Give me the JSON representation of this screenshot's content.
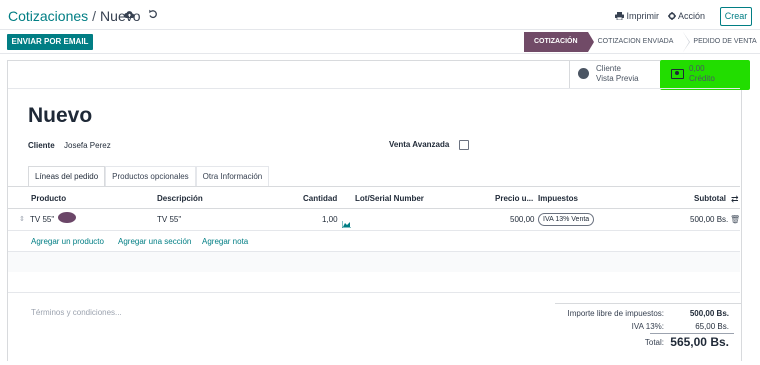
{
  "breadcrumb": {
    "parent": "Cotizaciones",
    "separator": "/",
    "current": "Nuevo"
  },
  "toolbar": {
    "print_label": "Imprimir",
    "action_label": "Acción",
    "create_label": "Crear"
  },
  "actions": {
    "email_label": "ENVIAR POR EMAIL"
  },
  "statusbar": {
    "stages": [
      {
        "label": "COTIZACIÓN",
        "active": true
      },
      {
        "label": "COTIZACION ENVIADA",
        "active": false
      },
      {
        "label": "PEDIDO DE VENTA",
        "active": false
      }
    ]
  },
  "smart_buttons": {
    "preview": {
      "line1": "Cliente",
      "line2": "Vista Previa",
      "icon": "globe-icon"
    },
    "credit": {
      "value": "0,00",
      "label": "Crédito",
      "icon": "money-icon",
      "highlight": "#22dd00"
    }
  },
  "form": {
    "title": "Nuevo",
    "customer_label": "Cliente",
    "customer_value": "Josefa Perez",
    "advanced_sale_label": "Venta Avanzada",
    "advanced_sale_checked": false
  },
  "tabs": [
    {
      "label": "Líneas del pedido",
      "active": true
    },
    {
      "label": "Productos opcionales",
      "active": false
    },
    {
      "label": "Otra Información",
      "active": false
    }
  ],
  "table": {
    "headers": {
      "product": "Producto",
      "description": "Descripción",
      "quantity": "Cantidad",
      "lot": "Lot/Serial Number",
      "price": "Precio u...",
      "taxes": "Impuestos",
      "subtotal": "Subtotal"
    },
    "rows": [
      {
        "product": "TV 55\"",
        "description": "TV 55\"",
        "quantity": "1,00",
        "lot": "",
        "price": "500,00",
        "tax": "IVA 13% Venta",
        "subtotal": "500,00 Bs."
      }
    ],
    "add_links": {
      "product": "Agregar un producto",
      "section": "Agregar una sección",
      "note": "Agregar nota"
    }
  },
  "footer": {
    "terms_placeholder": "Términos y condiciones...",
    "untaxed_label": "Importe libre de impuestos:",
    "untaxed_value": "500,00 Bs.",
    "tax_label": "IVA 13%:",
    "tax_value": "65,00 Bs.",
    "total_label": "Total:",
    "total_value": "565,00 Bs."
  },
  "colors": {
    "brand": "#017e84",
    "active_stage": "#714b67",
    "highlight": "#22dd00"
  }
}
